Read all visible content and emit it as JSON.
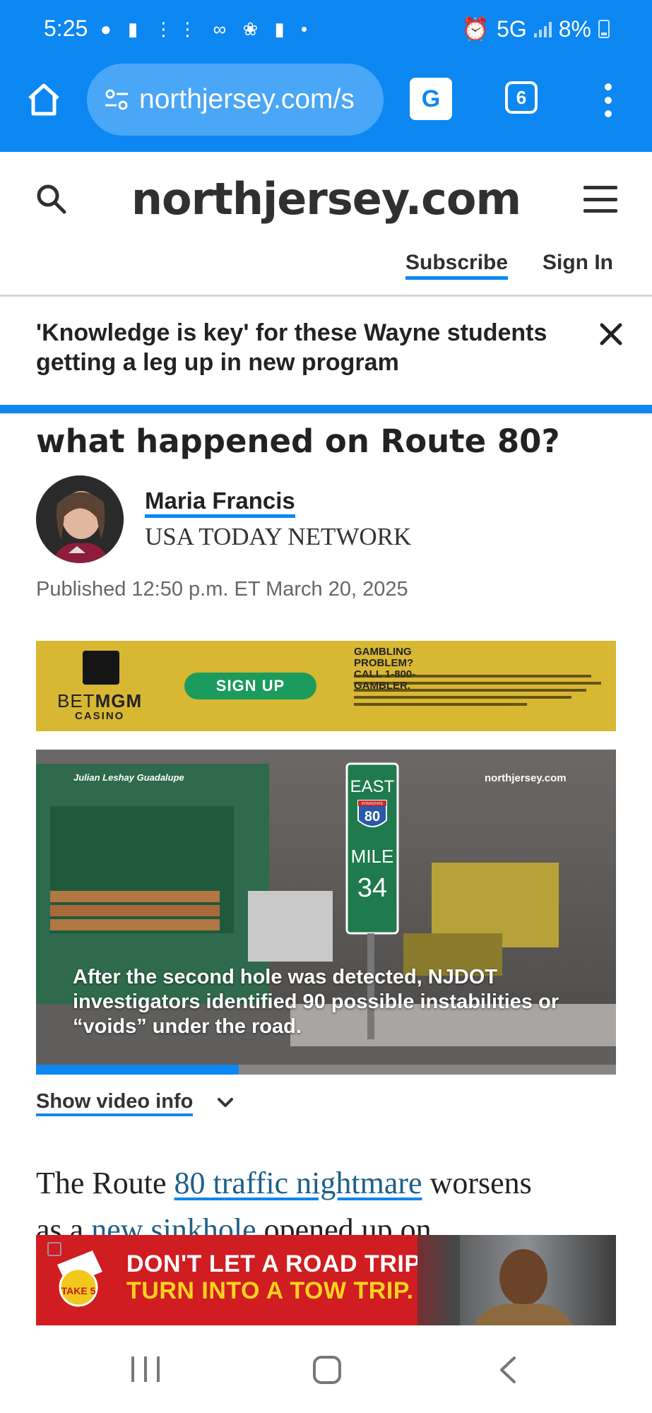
{
  "status_bar": {
    "time": "5:25",
    "network": "5G",
    "battery": "8%"
  },
  "browser": {
    "url": "northjersey.com/s",
    "tab_count": "6",
    "accent_color": "#0d87f2"
  },
  "site": {
    "logo": "northjersey.com",
    "subscribe_label": "Subscribe",
    "signin_label": "Sign In"
  },
  "banner": {
    "headline": "'Knowledge is key' for these Wayne students getting a leg up in new program"
  },
  "article": {
    "headline_fragment": "what happened on Route 80?",
    "author_name": "Maria Francis",
    "author_org": "USA TODAY NETWORK",
    "published": "Published 12:50 p.m. ET March 20, 2025",
    "show_video_info": "Show video info",
    "body_line1_pre": "The Route ",
    "body_line1_link": "80 traffic nightmare",
    "body_line1_post": " worsens",
    "body_line2_pre": "as a ",
    "body_line2_link": "new sinkhole",
    "body_line2_post": " opened up on"
  },
  "ad_betmgm": {
    "brand_pre": "BET",
    "brand_bold": "MGM",
    "casino": "CASINO",
    "cta": "SIGN UP",
    "problem_line1": "GAMBLING PROBLEM?",
    "problem_line2": "CALL 1-800-GAMBLER."
  },
  "video": {
    "credit": "Julian Leshay Guadalupe",
    "brand": "northjersey.com",
    "caption": "After the second hole was detected, NJDOT investigators identified 90 possible instabilities or “voids” under the road.",
    "sign_direction": "EAST",
    "sign_interstate": "INTERSTATE",
    "sign_route": "80",
    "sign_mile": "MILE",
    "sign_mile_number": "34",
    "progress_fraction": 0.35
  },
  "ad_take5": {
    "logo_text": "TAKE 5",
    "line1": "DON'T LET A ROAD TRIP",
    "line2": "TURN INTO A TOW TRIP."
  }
}
